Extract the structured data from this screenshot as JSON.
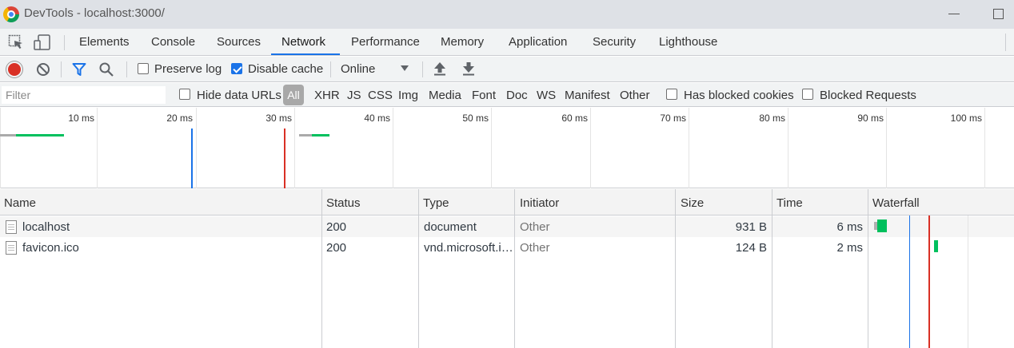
{
  "window": {
    "title": "DevTools - localhost:3000/"
  },
  "tabs": [
    "Elements",
    "Console",
    "Sources",
    "Network",
    "Performance",
    "Memory",
    "Application",
    "Security",
    "Lighthouse"
  ],
  "active_tab": "Network",
  "toolbar": {
    "preserve_log_label": "Preserve log",
    "preserve_log_checked": false,
    "disable_cache_label": "Disable cache",
    "disable_cache_checked": true,
    "throttle_value": "Online"
  },
  "filterbar": {
    "filter_placeholder": "Filter",
    "hide_data_urls_label": "Hide data URLs",
    "types": [
      "All",
      "XHR",
      "JS",
      "CSS",
      "Img",
      "Media",
      "Font",
      "Doc",
      "WS",
      "Manifest",
      "Other"
    ],
    "selected_type": "All",
    "has_blocked_cookies_label": "Has blocked cookies",
    "blocked_requests_label": "Blocked Requests"
  },
  "overview": {
    "ticks": [
      "10 ms",
      "20 ms",
      "30 ms",
      "40 ms",
      "50 ms",
      "60 ms",
      "70 ms",
      "80 ms",
      "90 ms",
      "100 ms"
    ],
    "dom_content_loaded_color": "#1a73e8",
    "load_color": "#d93025"
  },
  "table": {
    "columns": [
      "Name",
      "Status",
      "Type",
      "Initiator",
      "Size",
      "Time",
      "Waterfall"
    ],
    "rows": [
      {
        "name": "localhost",
        "status": "200",
        "type": "document",
        "initiator": "Other",
        "size": "931 B",
        "time": "6 ms"
      },
      {
        "name": "favicon.ico",
        "status": "200",
        "type": "vnd.microsoft.i…",
        "initiator": "Other",
        "size": "124 B",
        "time": "2 ms"
      }
    ]
  },
  "colors": {
    "accent": "#1a73e8",
    "record": "#d93025",
    "waterfall_bar": "#00c05d"
  }
}
